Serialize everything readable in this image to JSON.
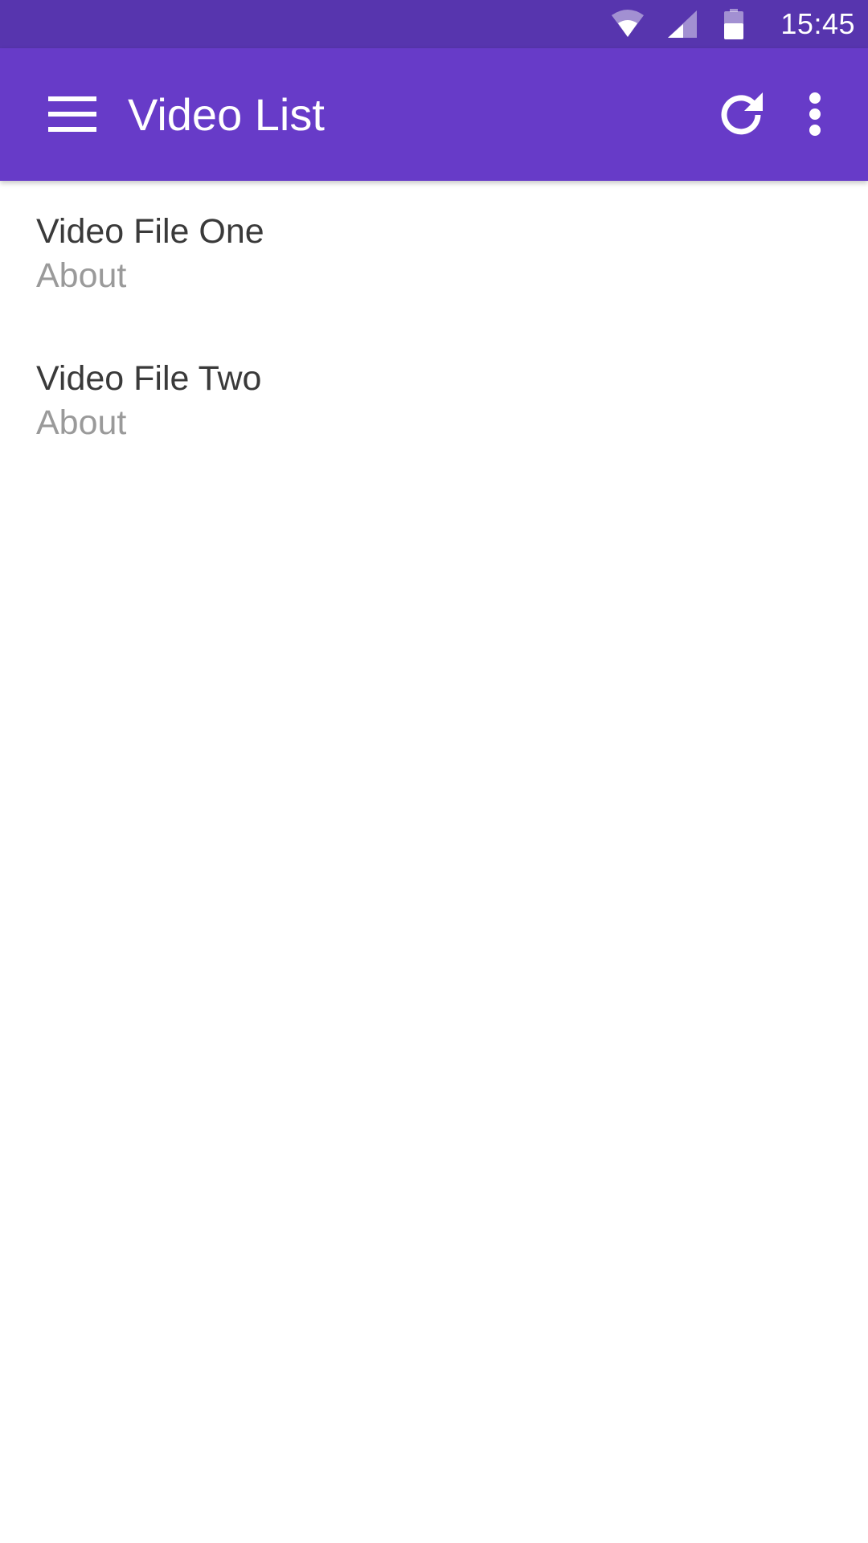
{
  "status_bar": {
    "time": "15:45",
    "icons": [
      "wifi-icon",
      "cell-signal-icon",
      "battery-icon"
    ]
  },
  "app_bar": {
    "title": "Video List",
    "menu_icon": "hamburger-menu-icon",
    "actions": [
      "refresh-icon",
      "more-vert-icon"
    ],
    "background_color": "#673bc8",
    "status_bar_color": "#5735ae"
  },
  "video_list": {
    "items": [
      {
        "title": "Video File One",
        "subtitle": "About"
      },
      {
        "title": "Video File Two",
        "subtitle": "About"
      }
    ]
  }
}
